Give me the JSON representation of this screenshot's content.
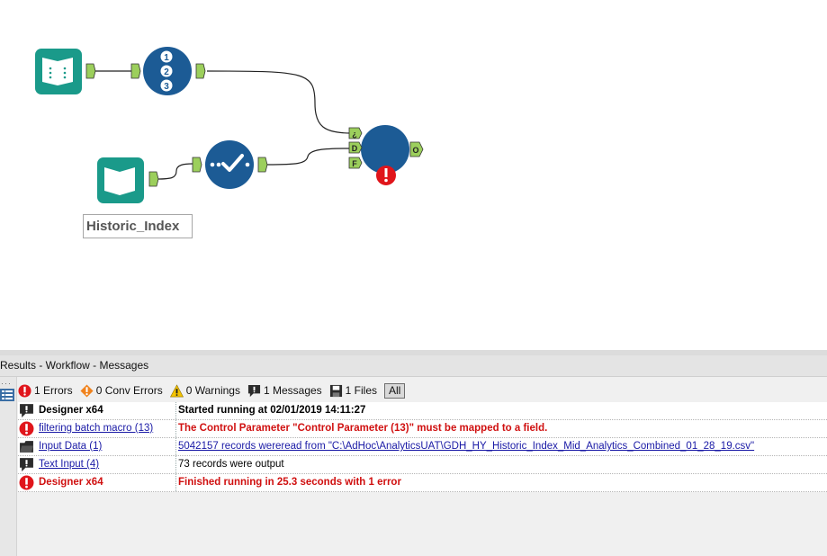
{
  "canvas": {
    "tool_label": "Historic_Index",
    "macro_anchors": {
      "top": "¿",
      "middle": "D",
      "bottom": "F",
      "output": "O"
    }
  },
  "results": {
    "title": "Results - Workflow - Messages",
    "filters": [
      {
        "icon": "error-icon",
        "label": "1 Errors"
      },
      {
        "icon": "conversion-error-icon",
        "label": "0 Conv Errors"
      },
      {
        "icon": "warning-icon",
        "label": "0 Warnings"
      },
      {
        "icon": "message-icon",
        "label": "1 Messages"
      },
      {
        "icon": "file-icon",
        "label": "1 Files"
      }
    ],
    "all_label": "All",
    "rows": [
      {
        "icon": "message-icon",
        "tool": "Designer x64",
        "message": "Started running  at 02/01/2019 14:11:27"
      },
      {
        "icon": "error-icon",
        "tool": "filtering batch macro (13)",
        "message": "The Control Parameter \"Control Parameter (13)\" must be mapped to a field."
      },
      {
        "icon": "file-icon",
        "tool": "Input Data (1)",
        "message": "5042157 records wereread from \"C:\\AdHoc\\AnalyticsUAT\\GDH_HY_Historic_Index_Mid_Analytics_Combined_01_28_19.csv\""
      },
      {
        "icon": "message-icon",
        "tool": "Text Input (4)",
        "message": "73 records were output"
      },
      {
        "icon": "error-icon",
        "tool": "Designer x64",
        "message": "Finished running  in 25.3 seconds with 1 error"
      }
    ]
  },
  "colors": {
    "tool_blue": "#1c5b95",
    "input_green": "#1a9a8a",
    "anchor_green": "#9ccf5c",
    "error_red": "#e0151b"
  }
}
